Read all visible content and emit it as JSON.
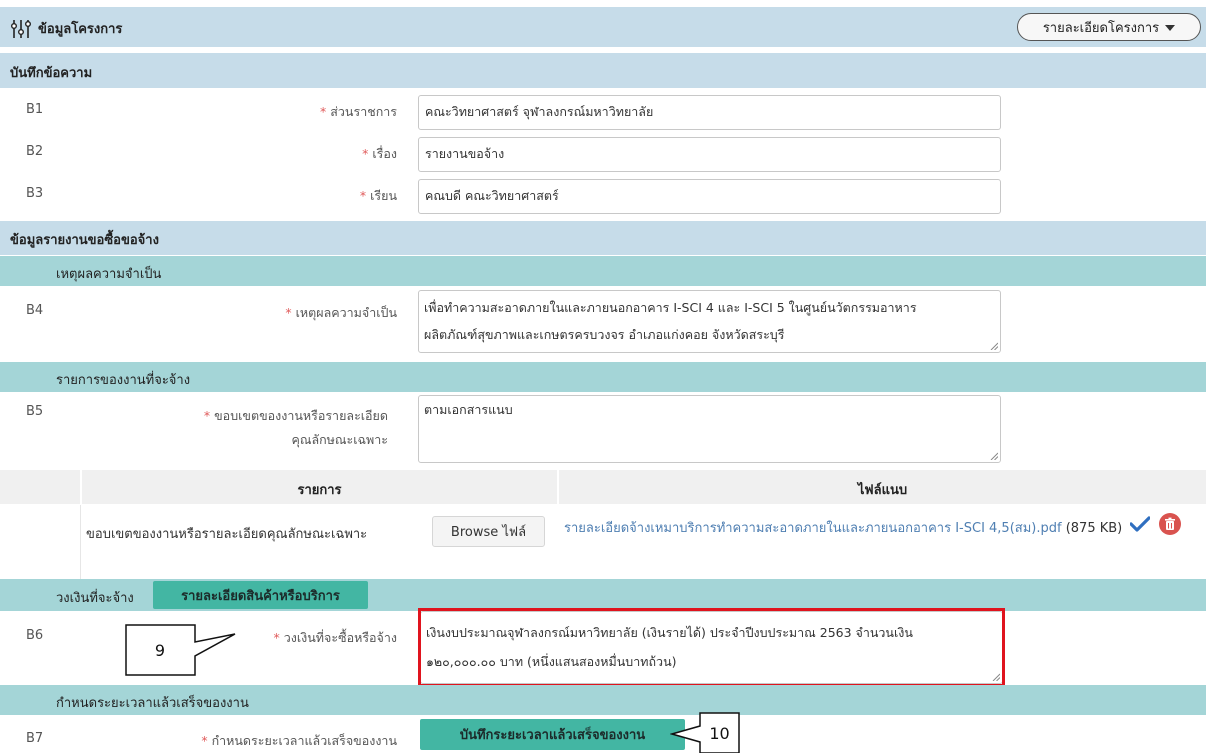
{
  "header": {
    "title": "ข้อมูลโครงการ",
    "dropdown_label": "รายละเอียดโครงการ"
  },
  "section_memo": {
    "title": "บันทึกข้อความ",
    "rows": [
      {
        "code": "B1",
        "label": "ส่วนราชการ",
        "value": "คณะวิทยาศาสตร์ จุฬาลงกรณ์มหาวิทยาลัย"
      },
      {
        "code": "B2",
        "label": "เรื่อง",
        "value": "รายงานขอจ้าง"
      },
      {
        "code": "B3",
        "label": "เรียน",
        "value": "คณบดี คณะวิทยาศาสตร์"
      }
    ]
  },
  "section_report": {
    "title": "ข้อมูลรายงานขอซื้อขอจ้าง",
    "necessity": {
      "subtitle": "เหตุผลความจำเป็น",
      "code": "B4",
      "label": "เหตุผลความจำเป็น",
      "value_line1": "เพื่อทำความสะอาดภายในและภายนอกอาคาร I-SCI 4 และ I-SCI 5 ในศูนย์นวัตกรรมอาหาร",
      "value_line2": "ผลิตภัณฑ์สุขภาพและเกษตรครบวงจร อำเภอแก่งคอย จังหวัดสระบุรี"
    },
    "work_items": {
      "subtitle": "รายการของงานที่จะจ้าง",
      "code": "B5",
      "label_line1": "ขอบเขตของงานหรือรายละเอียด",
      "label_line2": "คุณลักษณะเฉพาะ",
      "value": "ตามเอกสารแนบ",
      "table": {
        "col_item": "รายการ",
        "col_attachment": "ไฟล์แนบ",
        "row_item": "ขอบเขตของงานหรือรายละเอียดคุณลักษณะเฉพาะ",
        "browse_label": "Browse ไฟล์",
        "file_name": "รายละเอียดจ้างเหมาบริการทำความสะอาดภายในและภายนอกอาคาร I-SCI 4,5(สม).pdf",
        "file_size": "(875 KB)"
      }
    },
    "budget": {
      "subtitle": "วงเงินที่จะจ้าง",
      "details_button": "รายละเอียดสินค้าหรือบริการ",
      "code": "B6",
      "label": "วงเงินที่จะซื้อหรือจ้าง",
      "value_line1": "เงินงบประมาณจุฬาลงกรณ์มหาวิทยาลัย (เงินรายได้) ประจำปีงบประมาณ 2563 จำนวนเงิน",
      "value_line2": "๑๒๐,๐๐๐.๐๐ บาท (หนึ่งแสนสองหมื่นบาทถ้วน)"
    },
    "deadline": {
      "subtitle": "กำหนดระยะเวลาแล้วเสร็จของงาน",
      "code": "B7",
      "label": "กำหนดระยะเวลาแล้วเสร็จของงาน",
      "button": "บันทึกระยะเวลาแล้วเสร็จของงาน"
    }
  },
  "callouts": {
    "first": "9",
    "second": "10"
  },
  "colors": {
    "section_band": "#c6dce9",
    "subsection_band": "#a4d5d7",
    "teal_button": "#43b6a3",
    "required_mark": "#e05a5a",
    "link": "#4f7fb2",
    "highlight_box": "#e0141e"
  }
}
